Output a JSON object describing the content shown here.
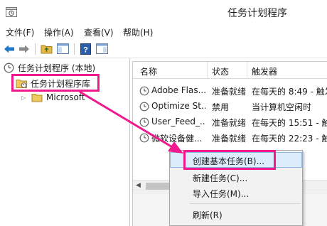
{
  "window": {
    "title": "任务计划程序"
  },
  "menu": [
    "文件(F)",
    "操作(A)",
    "查看(V)",
    "帮助(H)"
  ],
  "toolbar": [
    {
      "icon": "back-arrow-icon"
    },
    {
      "icon": "forward-arrow-icon"
    },
    {
      "icon": "folder-up-icon"
    },
    {
      "icon": "show-hide-tree-icon"
    },
    {
      "icon": "help-icon"
    },
    {
      "icon": "show-hide-action-pane-icon"
    }
  ],
  "tree": {
    "root": "任务计划程序 (本地)",
    "library": "任务计划程序库",
    "child": "Microsoft"
  },
  "list": {
    "columns": [
      "名称",
      "状态",
      "触发器"
    ],
    "rows": [
      {
        "name": "Adobe Flas...",
        "status": "准备就绪",
        "trigger": "在每天的 8:49 - 触发"
      },
      {
        "name": "Optimize St...",
        "status": "禁用",
        "trigger": "当计算机空闲时"
      },
      {
        "name": "User_Feed_...",
        "status": "准备就绪",
        "trigger": "在每天的 15:51 - 触"
      },
      {
        "name": "微软设备健...",
        "status": "准备就绪",
        "trigger": "在每天的 22:23 - 触"
      }
    ]
  },
  "context_menu": [
    "创建基本任务(B)...",
    "新建任务(C)...",
    "导入任务(M)...",
    "刷新(R)"
  ],
  "colors": {
    "highlight": "#f0198e",
    "menu_hover": "#dcecfc",
    "nav_arrow": "#1e78c8"
  }
}
